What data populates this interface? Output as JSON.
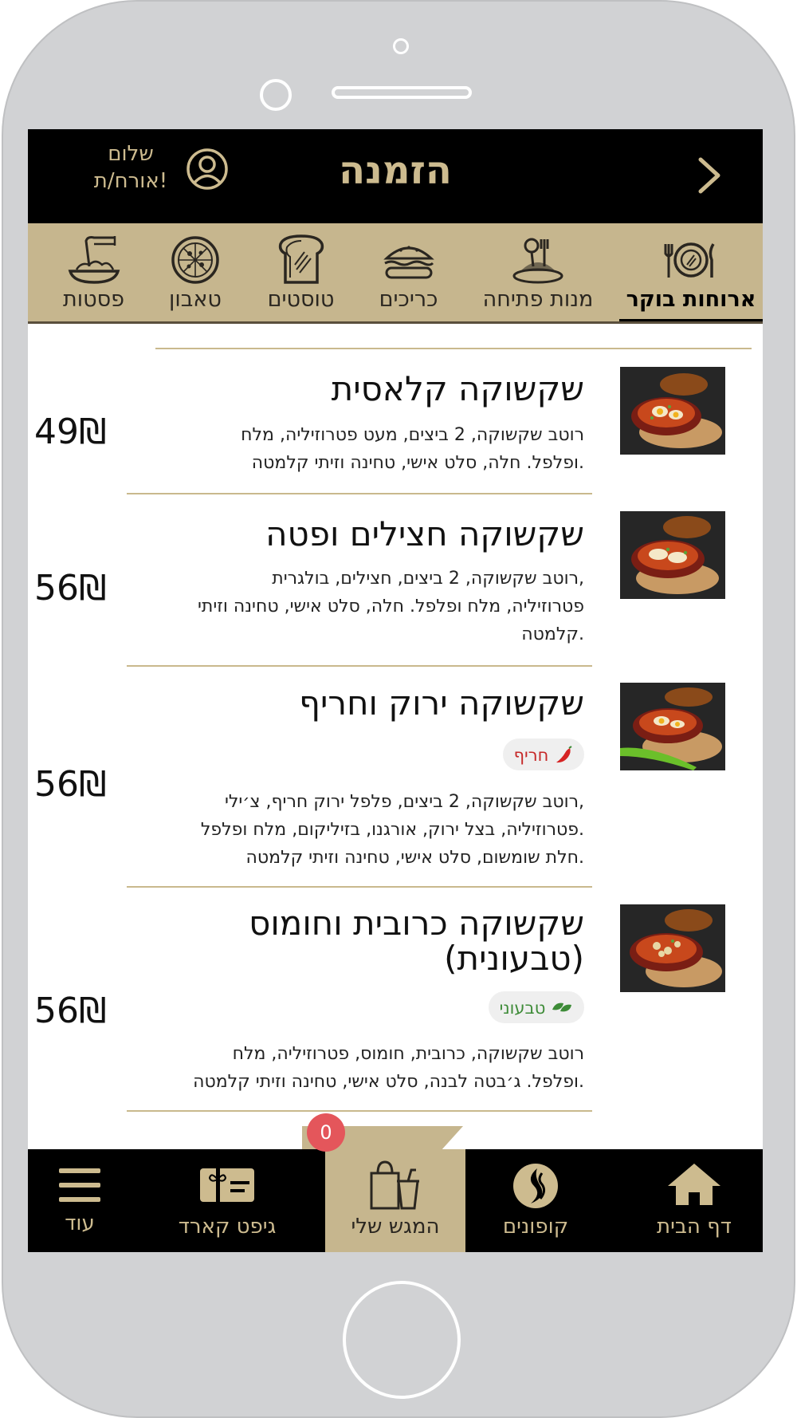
{
  "header": {
    "title": "הזמנה",
    "greeting_line1": "שלום",
    "greeting_line2": "אורח/ת!"
  },
  "categories": [
    {
      "label": "ארוחות בוקר",
      "icon": "plate-cutlery-icon",
      "active": true
    },
    {
      "label": "מנות פתיחה",
      "icon": "starter-dish-icon",
      "active": false
    },
    {
      "label": "כריכים",
      "icon": "sandwich-icon",
      "active": false
    },
    {
      "label": "טוסטים",
      "icon": "toast-icon",
      "active": false
    },
    {
      "label": "טאבון",
      "icon": "pizza-icon",
      "active": false
    },
    {
      "label": "פסטות",
      "icon": "pasta-icon",
      "active": false
    }
  ],
  "items": [
    {
      "name": "שקשוקה קלאסית",
      "desc_lines": [
        "רוטב שקשוקה, 2 ביצים, מעט פטרוזיליה, מלח",
        "ופלפל. חלה, סלט אישי, טחינה וזיתי קלמטה."
      ],
      "price": "49₪"
    },
    {
      "name": "שקשוקה חצילים ופטה",
      "desc_lines": [
        "רוטב שקשוקה, 2 ביצים, חצילים, בולגרית,",
        "פטרוזיליה, מלח ופלפל. חלה, סלט אישי, טחינה וזיתי",
        "קלמטה."
      ],
      "price": "56₪"
    },
    {
      "name": "שקשוקה ירוק וחריף",
      "badge": "חריף",
      "badge_icon": "chili-pepper-icon",
      "badge_color": "#c62828",
      "desc_lines": [
        "רוטב שקשוקה, 2 ביצים, פלפל ירוק חריף, צ׳ילי,",
        "פטרוזיליה, בצל ירוק, אורגנו, בזיליקום, מלח ופלפל.",
        "חלת שומשום, סלט אישי, טחינה וזיתי קלמטה."
      ],
      "price": "56₪"
    },
    {
      "name_lines": [
        "שקשוקה כרובית וחומוס",
        "(טבעונית)"
      ],
      "badge": "טבעוני",
      "badge_icon": "leaf-icon",
      "badge_color": "#3d8b37",
      "desc_lines": [
        "רוטב שקשוקה, כרובית, חומוס, פטרוזיליה, מלח",
        "ופלפל. ג׳בטה לבנה, סלט אישי, טחינה וזיתי קלמטה."
      ],
      "price": "56₪"
    }
  ],
  "bottom_nav": [
    {
      "label": "דף הבית",
      "icon": "home-icon"
    },
    {
      "label": "קופונים",
      "icon": "coupons-icon"
    },
    {
      "label": "המגש שלי",
      "icon": "shopping-bag-icon",
      "active": true
    },
    {
      "label": "גיפט קארד",
      "icon": "gift-card-icon"
    },
    {
      "label": "עוד",
      "icon": "menu-icon"
    }
  ],
  "cart_count": "0",
  "colors": {
    "gold": "#cdbb8f",
    "tan": "#c6b68e",
    "badge_red": "#e4565b"
  }
}
